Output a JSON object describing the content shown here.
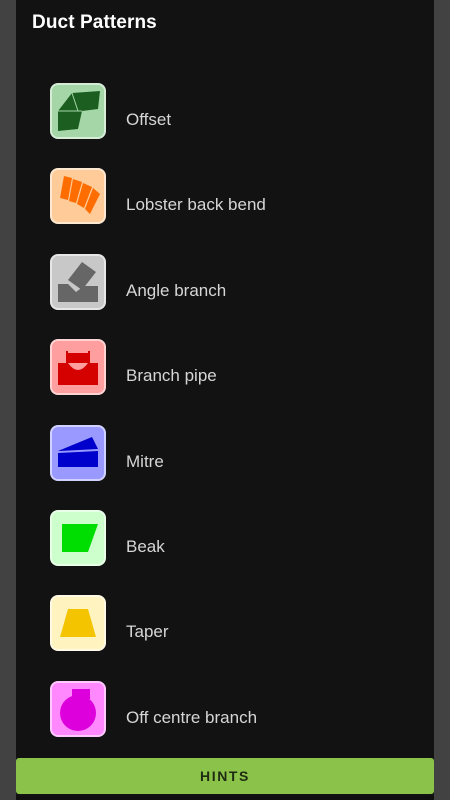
{
  "header": {
    "title": "Duct Patterns"
  },
  "items": [
    {
      "label": "Offset",
      "icon": "offset-icon",
      "bg": "#a5d6a7",
      "fg": "#1b5e20"
    },
    {
      "label": "Lobster back bend",
      "icon": "lobster-back-bend-icon",
      "bg": "#ffcc99",
      "fg": "#ff6d00"
    },
    {
      "label": "Angle branch",
      "icon": "angle-branch-icon",
      "bg": "#c8c8c8",
      "fg": "#666666"
    },
    {
      "label": "Branch pipe",
      "icon": "branch-pipe-icon",
      "bg": "#ff9e9e",
      "fg": "#d50000"
    },
    {
      "label": "Mitre",
      "icon": "mitre-icon",
      "bg": "#9999ff",
      "fg": "#0000cc"
    },
    {
      "label": "Beak",
      "icon": "beak-icon",
      "bg": "#ccffcc",
      "fg": "#00dd00"
    },
    {
      "label": "Taper",
      "icon": "taper-icon",
      "bg": "#fff3c0",
      "fg": "#f5c400"
    },
    {
      "label": "Off centre branch",
      "icon": "off-centre-branch-icon",
      "bg": "#ff88ff",
      "fg": "#dd00dd"
    }
  ],
  "footer": {
    "hints_label": "HINTS"
  },
  "colors": {
    "accent": "#8bc34a",
    "background": "#121212"
  }
}
